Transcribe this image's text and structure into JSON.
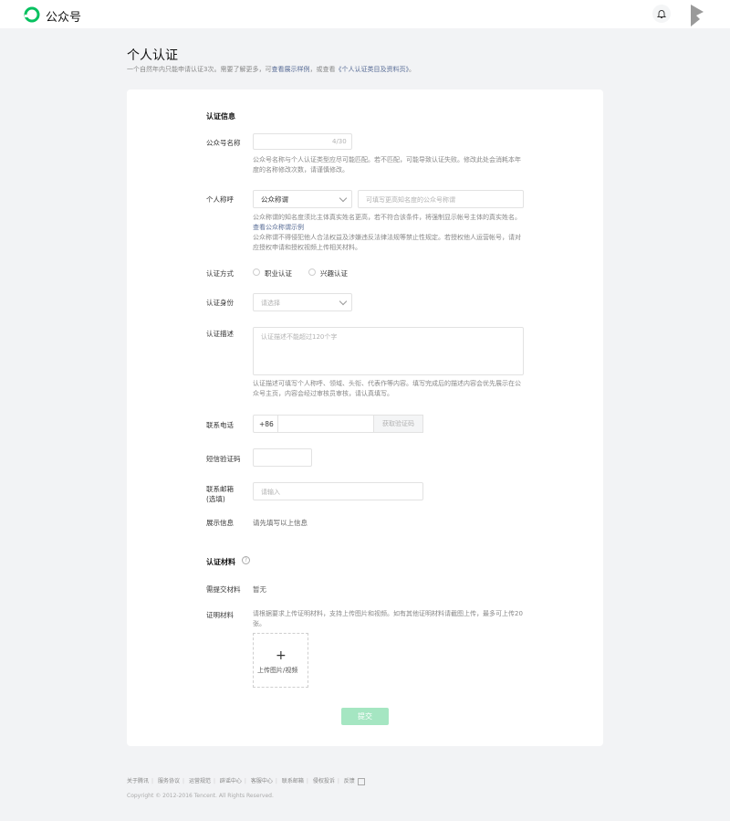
{
  "header": {
    "brand": "公众号"
  },
  "page": {
    "title": "个人认证",
    "desc_prefix": "一个自然年内只能申请认证3次。需要了解更多，可",
    "desc_link1": "查看展示样例",
    "desc_mid": "，或查看",
    "desc_link2": "《个人认证类目及资料页》",
    "desc_suffix": "。"
  },
  "form": {
    "section_info": "认证信息",
    "account_name": {
      "label": "公众号名称",
      "counter": "4/30",
      "hint": "公众号名称与个人认证类型应尽可能匹配。若不匹配，可能导致认证失败。修改此处会消耗本年度的名称修改次数，请谨慎修改。"
    },
    "personal_title": {
      "label": "个人称呼",
      "select_value": "公众称谓",
      "placeholder": "可填写更高知名度的公众号称谓",
      "hint1": "公众称谓的知名度须比主体真实姓名更高，若不符合该条件，将强制显示帐号主体的真实姓名。",
      "hint_link": "查看公众称谓示例",
      "hint2": "公众称谓不得侵犯他人合法权益及涉嫌违反法律法规等禁止性规定。若授权他人运营帐号，请对应授权申请和授权视频上传相关材料。"
    },
    "method": {
      "label": "认证方式",
      "option1": "职业认证",
      "option2": "兴趣认证"
    },
    "identity": {
      "label": "认证身份",
      "placeholder": "请选择"
    },
    "description": {
      "label": "认证描述",
      "placeholder": "认证描述不能超过120个字",
      "hint": "认证描述可填写个人称呼、领域、头衔、代表作等内容。填写完成后的描述内容会优先展示在公众号主页，内容会经过审核员审核，请认真填写。"
    },
    "phone": {
      "label": "联系电话",
      "prefix": "+86",
      "code_button": "获取验证码"
    },
    "sms": {
      "label": "短信验证码"
    },
    "email": {
      "label": "联系邮箱",
      "label_sub": "(选填)",
      "placeholder": "请输入"
    },
    "display": {
      "label": "展示信息",
      "value": "请先填写以上信息"
    },
    "section_materials": "认证材料",
    "required_materials": {
      "label": "需提交材料",
      "value": "暂无"
    },
    "proof": {
      "label": "证明材料",
      "hint": "请根据要求上传证明材料，支持上传图片和视频。如有其他证明材料请截图上传，最多可上传20张。",
      "upload_label": "上传图片/视频"
    },
    "submit": "提交"
  },
  "footer": {
    "links": [
      "关于腾讯",
      "服务协议",
      "运营规范",
      "辟谣中心",
      "客服中心",
      "联系邮箱",
      "侵权投诉",
      "反馈"
    ],
    "copyright": "Copyright © 2012-2016 Tencent. All Rights Reserved."
  },
  "colors": {
    "brand_green": "#07c160",
    "link": "#576b95",
    "submit_disabled": "#a5e6c2"
  }
}
